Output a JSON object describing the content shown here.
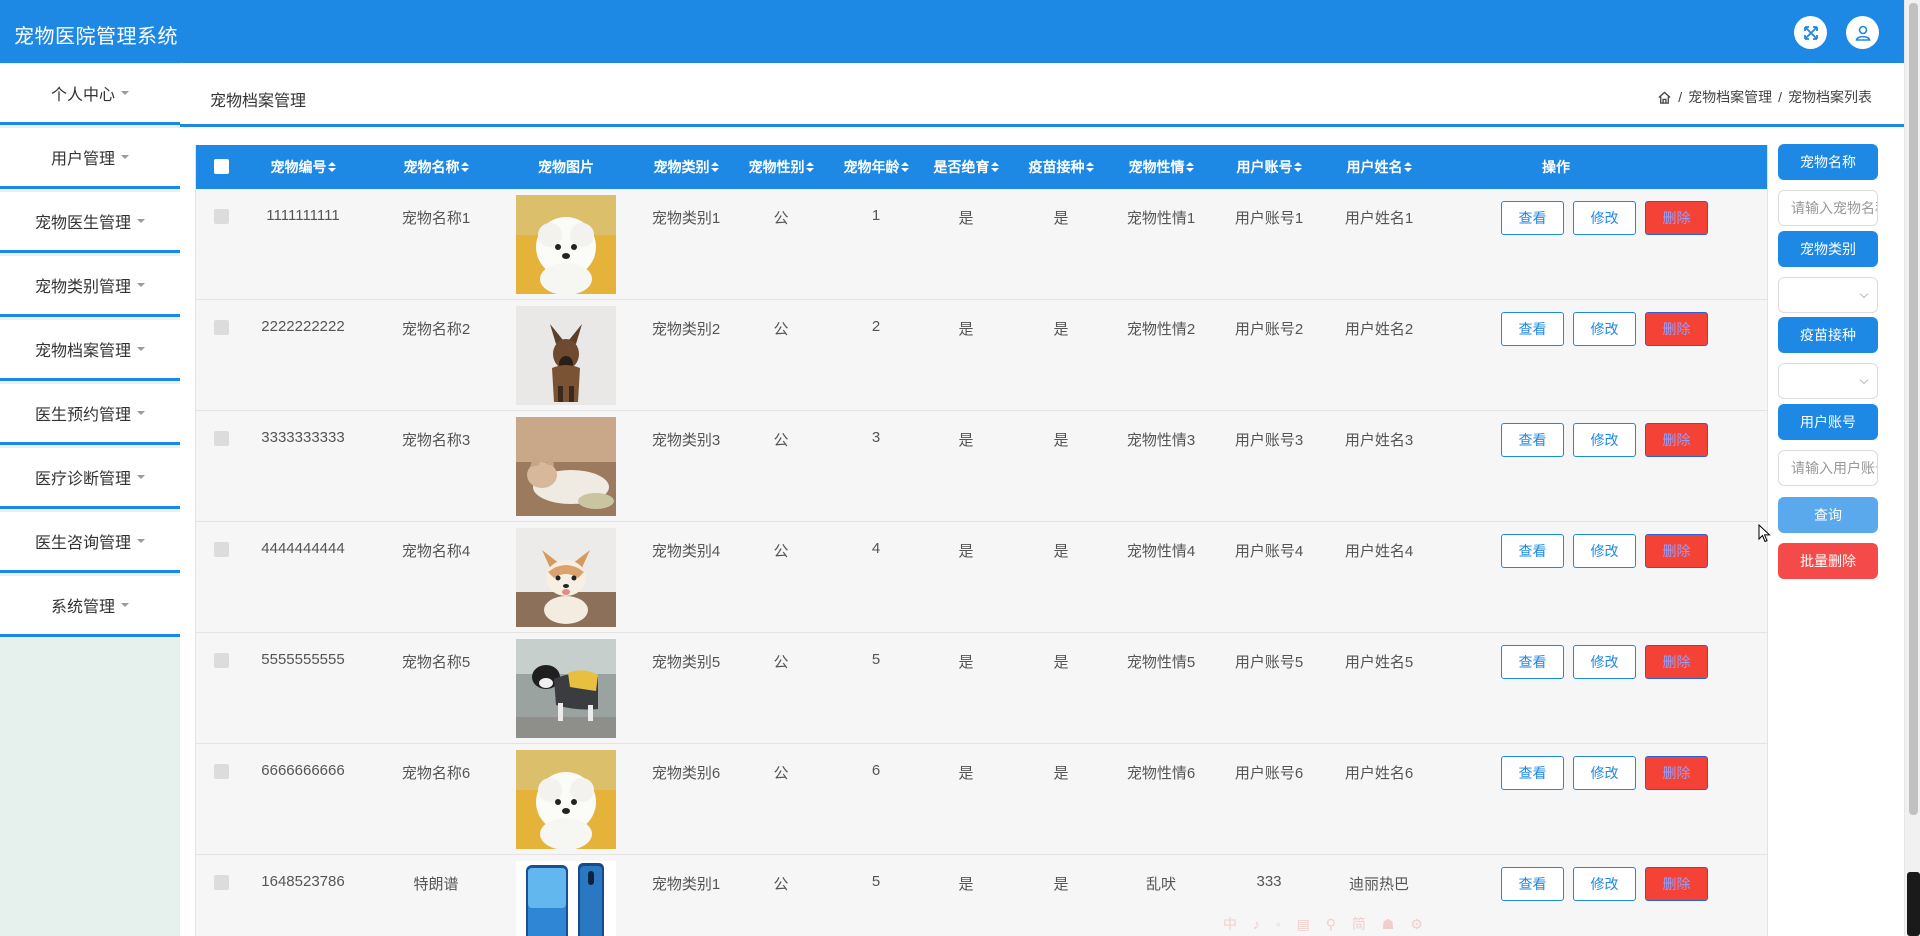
{
  "app": {
    "title": "宠物医院管理系统"
  },
  "header": {
    "fullscreen_icon": "fullscreen-icon",
    "user_icon": "user-avatar-icon"
  },
  "sidebar": {
    "items": [
      {
        "label": "个人中心"
      },
      {
        "label": "用户管理"
      },
      {
        "label": "宠物医生管理"
      },
      {
        "label": "宠物类别管理"
      },
      {
        "label": "宠物档案管理"
      },
      {
        "label": "医生预约管理"
      },
      {
        "label": "医疗诊断管理"
      },
      {
        "label": "医生咨询管理"
      },
      {
        "label": "系统管理"
      }
    ]
  },
  "page": {
    "title": "宠物档案管理"
  },
  "breadcrumb": {
    "sep": "/",
    "items": [
      "宠物档案管理",
      "宠物档案列表"
    ]
  },
  "table": {
    "columns": [
      "宠物编号",
      "宠物名称",
      "宠物图片",
      "宠物类别",
      "宠物性别",
      "宠物年龄",
      "是否绝育",
      "疫苗接种",
      "宠物性情",
      "用户账号",
      "用户姓名",
      "操作"
    ],
    "actions": {
      "view": "查看",
      "edit": "修改",
      "delete": "删除"
    },
    "rows": [
      {
        "id": "1111111111",
        "name": "宠物名称1",
        "image": "white-poodle",
        "category": "宠物类别1",
        "sex": "公",
        "age": "1",
        "neutered": "是",
        "vaccinated": "是",
        "temper": "宠物性情1",
        "account": "用户账号1",
        "username": "用户姓名1"
      },
      {
        "id": "2222222222",
        "name": "宠物名称2",
        "image": "brown-shepherd-dog",
        "category": "宠物类别2",
        "sex": "公",
        "age": "2",
        "neutered": "是",
        "vaccinated": "是",
        "temper": "宠物性情2",
        "account": "用户账号2",
        "username": "用户姓名2"
      },
      {
        "id": "3333333333",
        "name": "宠物名称3",
        "image": "lying-kitten",
        "category": "宠物类别3",
        "sex": "公",
        "age": "3",
        "neutered": "是",
        "vaccinated": "是",
        "temper": "宠物性情3",
        "account": "用户账号3",
        "username": "用户姓名3"
      },
      {
        "id": "4444444444",
        "name": "宠物名称4",
        "image": "corgi-puppy",
        "category": "宠物类别4",
        "sex": "公",
        "age": "4",
        "neutered": "是",
        "vaccinated": "是",
        "temper": "宠物性情4",
        "account": "用户账号4",
        "username": "用户姓名4"
      },
      {
        "id": "5555555555",
        "name": "宠物名称5",
        "image": "dog-in-coat",
        "category": "宠物类别5",
        "sex": "公",
        "age": "5",
        "neutered": "是",
        "vaccinated": "是",
        "temper": "宠物性情5",
        "account": "用户账号5",
        "username": "用户姓名5"
      },
      {
        "id": "6666666666",
        "name": "宠物名称6",
        "image": "white-poodle",
        "category": "宠物类别6",
        "sex": "公",
        "age": "6",
        "neutered": "是",
        "vaccinated": "是",
        "temper": "宠物性情6",
        "account": "用户账号6",
        "username": "用户姓名6"
      },
      {
        "id": "1648523786",
        "name": "特朗谱",
        "image": "blue-phone",
        "category": "宠物类别1",
        "sex": "公",
        "age": "5",
        "neutered": "是",
        "vaccinated": "是",
        "temper": "乱吠",
        "account": "333",
        "username": "迪丽热巴"
      }
    ]
  },
  "search": {
    "pet_name_label": "宠物名称",
    "pet_name_placeholder": "请输入宠物名称",
    "category_label": "宠物类别",
    "vaccine_label": "疫苗接种",
    "account_label": "用户账号",
    "account_placeholder": "请输入用户账号",
    "query_button": "查询",
    "batch_delete_button": "批量删除"
  },
  "colors": {
    "primary": "#1e88e5",
    "danger": "#f44336",
    "query": "#5aa9ec",
    "sidebar_bg": "#e6f0ec"
  },
  "ime_toolbar": "中 ♪ ◦ ▤ ⚲ 简 ☗ ⚙"
}
